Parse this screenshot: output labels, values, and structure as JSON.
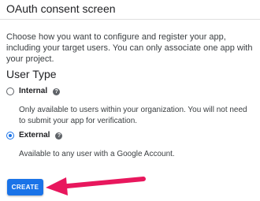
{
  "header": {
    "title": "OAuth consent screen"
  },
  "intro": "Choose how you want to configure and register your app, including your target users. You can only associate one app with your project.",
  "user_type": {
    "title": "User Type",
    "options": [
      {
        "label": "Internal",
        "help_icon": "?",
        "selected": false,
        "description": "Only available to users within your organization. You will not need to submit your app for verification."
      },
      {
        "label": "External",
        "help_icon": "?",
        "selected": true,
        "description": "Available to any user with a Google Account."
      }
    ]
  },
  "actions": {
    "create_label": "CREATE"
  },
  "annotation": {
    "arrow_color": "#e8175d"
  },
  "colors": {
    "accent": "#1a73e8"
  }
}
